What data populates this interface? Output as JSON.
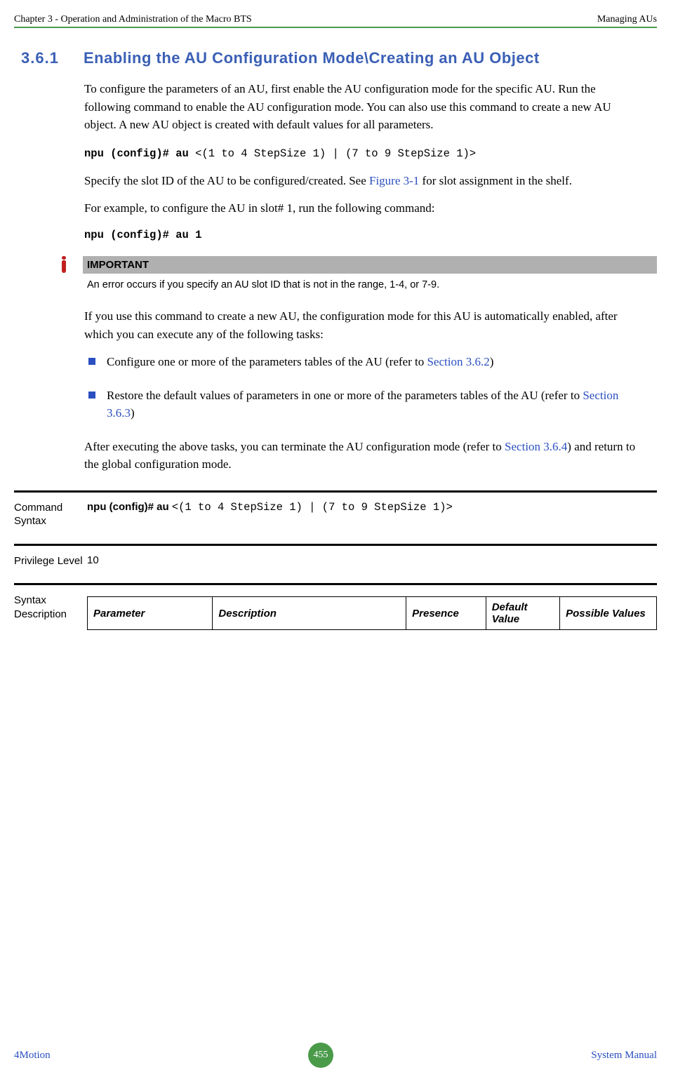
{
  "header": {
    "left": "Chapter 3 - Operation and Administration of the Macro BTS",
    "right": "Managing AUs"
  },
  "section": {
    "number": "3.6.1",
    "title": "Enabling the AU Configuration Mode\\Creating an AU Object"
  },
  "para1": "To configure the parameters of an AU, first enable the AU configuration mode for the specific AU. Run the following command to enable the AU configuration mode. You can also use this command to create a new AU object. A new AU object is created with default values for all parameters.",
  "cmd1_bold": "npu (config)# au ",
  "cmd1_rest": "<(1 to 4 StepSize 1) | (7 to 9 StepSize 1)>",
  "para2_a": "Specify the slot ID of the AU to be configured/created. See ",
  "para2_link": "Figure 3-1",
  "para2_b": " for slot assignment in the shelf.",
  "para3": "For example, to configure the AU in slot# 1, run the following command:",
  "cmd2": "npu (config)# au 1",
  "important": {
    "label": "IMPORTANT",
    "text": "An error occurs if you specify an AU slot ID that is not in the range, 1-4, or 7-9."
  },
  "para4": "If you use this command to create a new AU, the configuration mode for this AU is automatically enabled, after which you can execute any of the following tasks:",
  "bullets": [
    {
      "a": "Configure one or more of the parameters tables of the AU (refer to ",
      "link": "Section 3.6.2",
      "b": ")"
    },
    {
      "a": "Restore the default values of parameters in one or more of the parameters tables of the AU (refer to ",
      "link": "Section 3.6.3",
      "b": ")"
    }
  ],
  "para5_a": "After executing the above tasks, you can terminate the AU configuration mode (refer to ",
  "para5_link": "Section 3.6.4",
  "para5_b": ") and return to the global configuration mode.",
  "deftable": {
    "row1_label": "Command Syntax",
    "row1_bold": "npu (config)# au ",
    "row1_rest": "<(1 to 4 StepSize 1) | (7 to 9 StepSize 1)>",
    "row2_label": "Privilege Level",
    "row2_value": "10",
    "row3_label": "Syntax Description",
    "cols": [
      "Parameter",
      "Description",
      "Presence",
      "Default Value",
      "Possible Values"
    ]
  },
  "footer": {
    "left": "4Motion",
    "page": "455",
    "right": "System Manual"
  }
}
